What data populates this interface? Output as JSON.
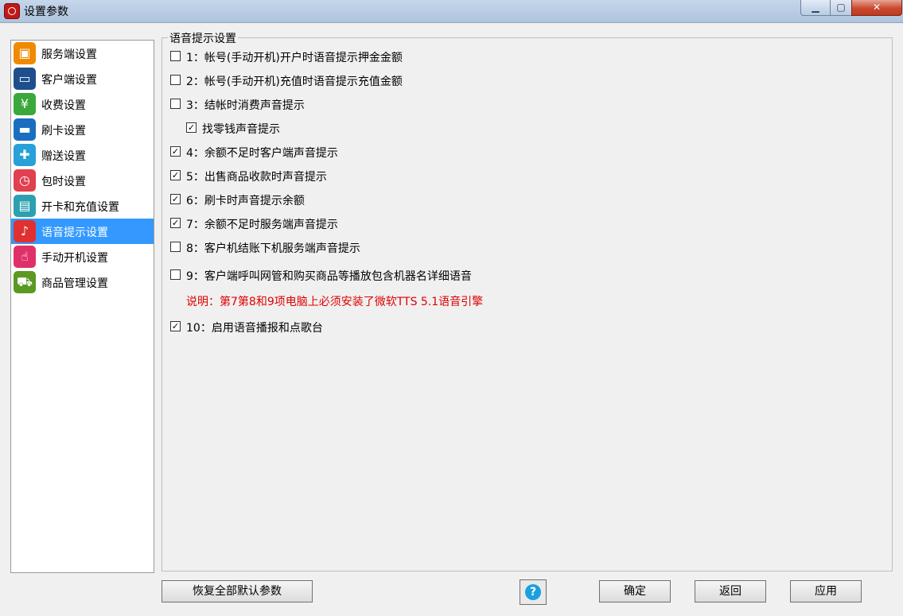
{
  "window": {
    "title": "设置参数",
    "minimize_icon": "minimize-icon",
    "maximize_icon": "maximize-icon",
    "close_icon": "close-icon"
  },
  "nav": {
    "items": [
      {
        "label": "服务端设置",
        "icon": "server-icon",
        "color": "#f08a00",
        "glyph": "▣"
      },
      {
        "label": "客户端设置",
        "icon": "monitor-icon",
        "color": "#1e4f8c",
        "glyph": "▭"
      },
      {
        "label": "收费设置",
        "icon": "billing-icon",
        "color": "#3aa83a",
        "glyph": "¥"
      },
      {
        "label": "刷卡设置",
        "icon": "card-icon",
        "color": "#1a6ec0",
        "glyph": "▬"
      },
      {
        "label": "赠送设置",
        "icon": "gift-icon",
        "color": "#28a0d8",
        "glyph": "✚"
      },
      {
        "label": "包时设置",
        "icon": "clock-icon",
        "color": "#e04050",
        "glyph": "◷"
      },
      {
        "label": "开卡和充值设置",
        "icon": "id-card-icon",
        "color": "#2aa0b0",
        "glyph": "▤"
      },
      {
        "label": "语音提示设置",
        "icon": "microphone-icon",
        "color": "#e03030",
        "glyph": "♪"
      },
      {
        "label": "手动开机设置",
        "icon": "hand-pointer-icon",
        "color": "#e0306a",
        "glyph": "☝"
      },
      {
        "label": "商品管理设置",
        "icon": "cart-icon",
        "color": "#5a9a20",
        "glyph": "⛟"
      }
    ],
    "selected_index": 7
  },
  "group": {
    "title": "语音提示设置",
    "options": [
      {
        "label": "1：帐号(手动开机)开户时语音提示押金金额",
        "checked": false
      },
      {
        "label": "2：帐号(手动开机)充值时语音提示充值金额",
        "checked": false
      },
      {
        "label": "3：结帐时消费声音提示",
        "checked": false
      },
      {
        "label": "找零钱声音提示",
        "checked": true
      },
      {
        "label": "4：余额不足时客户端声音提示",
        "checked": true
      },
      {
        "label": "5：出售商品收款时声音提示",
        "checked": true
      },
      {
        "label": "6：刷卡时声音提示余额",
        "checked": true
      },
      {
        "label": "7：余额不足时服务端声音提示",
        "checked": true
      },
      {
        "label": "8：客户机结账下机服务端声音提示",
        "checked": false
      },
      {
        "label": "9：客户端呼叫网管和购买商品等播放包含机器名详细语音",
        "checked": false
      },
      {
        "label": "10：启用语音播报和点歌台",
        "checked": true
      }
    ],
    "note": "说明：第7第8和9项电脑上必须安装了微软TTS 5.1语音引擎",
    "note_color": "#e00000"
  },
  "buttons": {
    "restore_defaults": "恢复全部默认参数",
    "help_icon": "help-icon",
    "ok": "确定",
    "back": "返回",
    "apply": "应用"
  },
  "colors": {
    "selection": "#3399ff",
    "titlebar": "#b9cde5"
  }
}
